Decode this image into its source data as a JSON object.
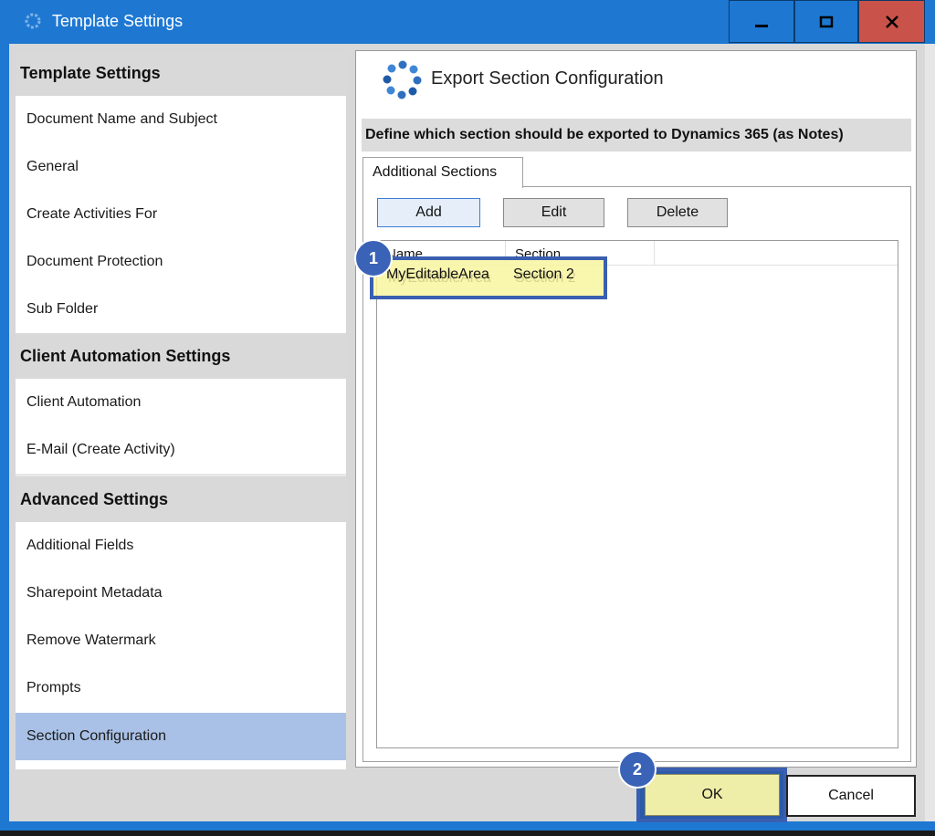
{
  "window": {
    "title": "Template Settings",
    "icon": "gear-icon",
    "controls": {
      "minimize": "minimize-icon",
      "maximize": "maximize-icon",
      "close": "close-icon"
    }
  },
  "sidebar": {
    "sections": [
      {
        "header": "Template Settings",
        "items": [
          "Document Name and Subject",
          "General",
          "Create Activities For",
          "Document Protection",
          "Sub Folder"
        ]
      },
      {
        "header": "Client Automation Settings",
        "items": [
          "Client Automation",
          "E-Mail (Create Activity)"
        ]
      },
      {
        "header": "Advanced Settings",
        "items": [
          "Additional Fields",
          "Sharepoint Metadata",
          "Remove Watermark",
          "Prompts",
          "Section Configuration"
        ]
      }
    ],
    "selected_item": "Section Configuration"
  },
  "panel": {
    "title": "Export Section Configuration",
    "description": "Define which section should be exported to Dynamics 365 (as Notes)",
    "tab_label": "Additional Sections",
    "buttons": {
      "add": "Add",
      "edit": "Edit",
      "delete": "Delete"
    },
    "list": {
      "columns": [
        "Name",
        "Section"
      ],
      "rows": [
        {
          "name": "MyEditableArea",
          "section": "Section 2"
        }
      ]
    }
  },
  "annotations": {
    "badge1": "1",
    "badge2": "2"
  },
  "footer": {
    "ok": "OK",
    "cancel": "Cancel"
  },
  "colors": {
    "titlebar": "#1e78d2",
    "close": "#c9534a",
    "selected": "#a9c1e6",
    "highlight": "#f8f4a0",
    "badge": "#3a63b8"
  }
}
